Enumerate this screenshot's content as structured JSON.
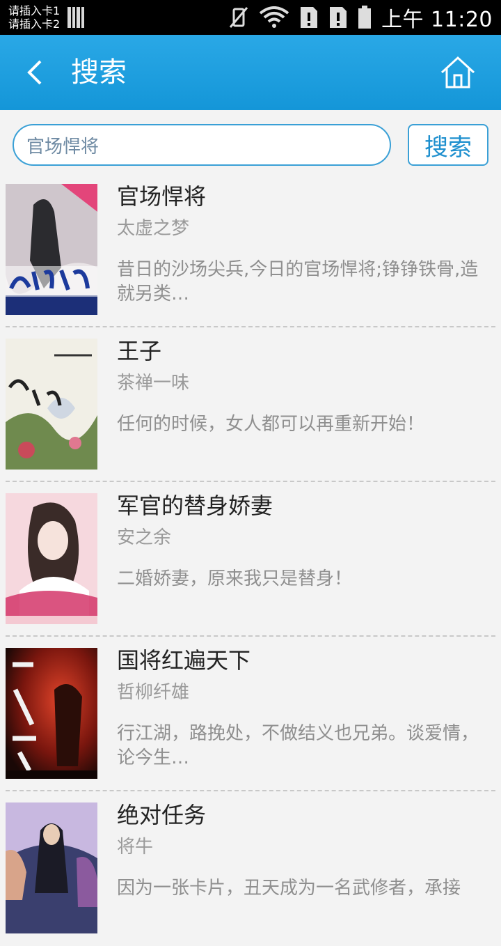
{
  "status_bar": {
    "sim1": "请插入卡1",
    "sim2": "请插入卡2",
    "time": "上午 11:20"
  },
  "header": {
    "title": "搜索"
  },
  "search": {
    "value": "官场悍将",
    "button_label": "搜索"
  },
  "books": [
    {
      "title": "官场悍将",
      "author": "太虚之梦",
      "description": "昔日的沙场尖兵,今日的官场悍将;铮铮铁骨,造就另类…"
    },
    {
      "title": "王子",
      "author": "茶禅一味",
      "description": "任何的时候，女人都可以再重新开始！"
    },
    {
      "title": "军官的替身娇妻",
      "author": "安之余",
      "description": "二婚娇妻，原来我只是替身！"
    },
    {
      "title": "国将红遍天下",
      "author": "哲柳纤雄",
      "description": "行江湖，路挽处，不做结义也兄弟。谈爱情，论今生…"
    },
    {
      "title": "绝对任务",
      "author": "将牛",
      "description": "因为一张卡片，丑天成为一名武修者，承接"
    }
  ]
}
